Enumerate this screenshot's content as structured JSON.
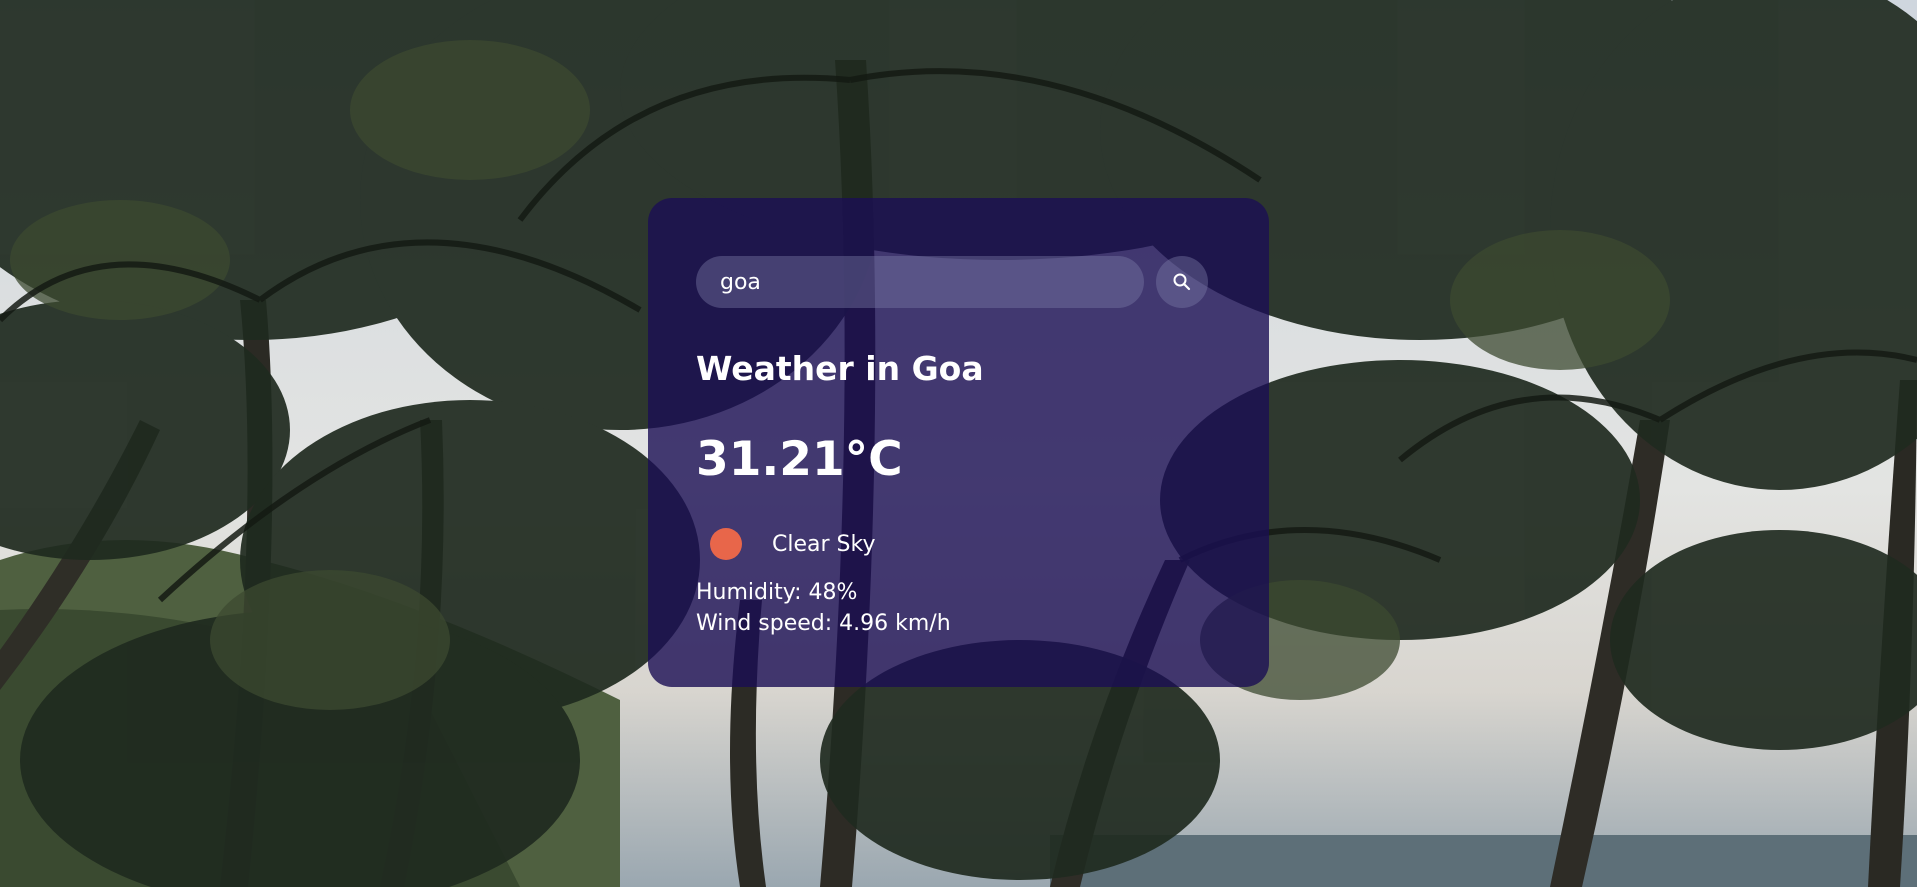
{
  "search": {
    "value": "goa",
    "button_icon": "search-icon"
  },
  "weather": {
    "title": "Weather in Goa",
    "temperature": "31.21°C",
    "condition": "Clear Sky",
    "condition_icon": "sun-icon",
    "humidity": "Humidity: 48%",
    "wind": "Wind speed: 4.96 km/h"
  },
  "colors": {
    "card_background": "#1a0e54",
    "condition_icon": "#e8664a",
    "text": "#ffffff"
  }
}
